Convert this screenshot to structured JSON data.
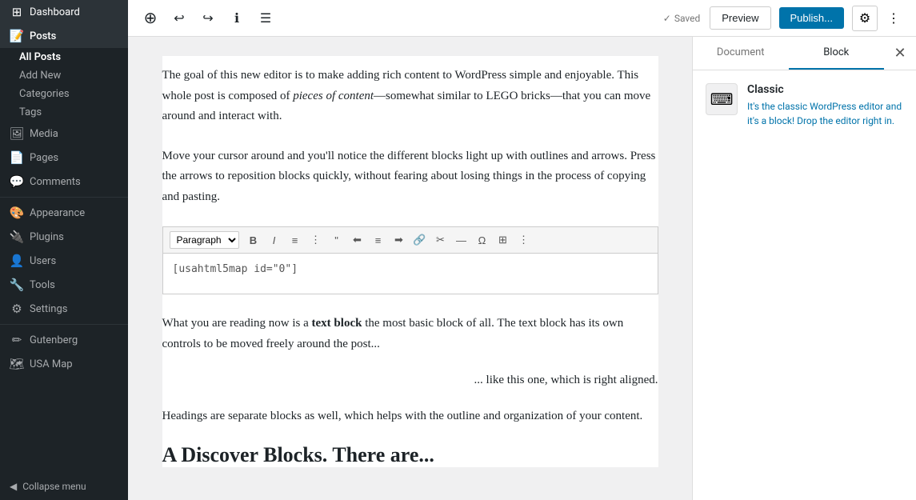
{
  "sidebar": {
    "dashboard_label": "Dashboard",
    "posts_label": "Posts",
    "all_posts_label": "All Posts",
    "add_new_label": "Add New",
    "categories_label": "Categories",
    "tags_label": "Tags",
    "media_label": "Media",
    "pages_label": "Pages",
    "comments_label": "Comments",
    "appearance_label": "Appearance",
    "plugins_label": "Plugins",
    "users_label": "Users",
    "tools_label": "Tools",
    "settings_label": "Settings",
    "gutenberg_label": "Gutenberg",
    "usa_map_label": "USA Map",
    "collapse_label": "Collapse menu"
  },
  "toolbar": {
    "saved_label": "Saved",
    "preview_label": "Preview",
    "publish_label": "Publish..."
  },
  "editor": {
    "paragraph1": "The goal of this new editor is to make adding rich content to WordPress simple and enjoyable. This whole post is composed of pieces of content—somewhat similar to LEGO bricks—that you can move around and interact with.",
    "paragraph1_italic": "pieces of content",
    "paragraph2": "Move your cursor around and you'll notice the different blocks light up with outlines and arrows. Press the arrows to reposition blocks quickly, without fearing about losing things in the process of copying and pasting.",
    "paragraph_format": "Paragraph",
    "shortcode": "[usahtml5map id=\"0\"]",
    "paragraph3_plain": "What you are reading now is a ",
    "paragraph3_bold": "text block",
    "paragraph3_rest": " the most basic block of all. The text block has its own controls to be moved freely around the post...",
    "paragraph4": "... like this one, which is right aligned.",
    "paragraph5": "Headings are separate blocks as well, which helps with the outline and organization of your content.",
    "heading_partial": "A Discover Blocks. There are..."
  },
  "right_panel": {
    "document_tab": "Document",
    "block_tab": "Block",
    "block_name": "Classic",
    "block_description": "It's the classic WordPress editor and it's a block! Drop the editor right in."
  }
}
